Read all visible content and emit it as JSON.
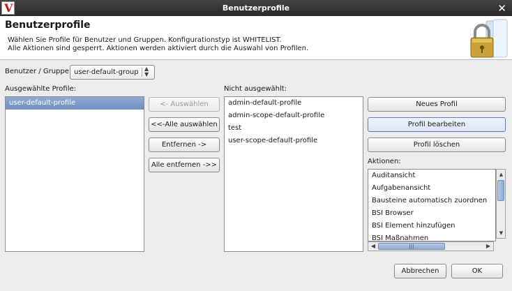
{
  "window": {
    "title": "Benutzerprofile",
    "close_glyph": "✕"
  },
  "header": {
    "title": "Benutzerprofile",
    "description_line1": "Wählen Sie Profile für Benutzer und Gruppen. Konfigurationstyp ist WHITELIST.",
    "description_line2": "Alle Aktionen sind gesperrt. Aktionen werden aktiviert durch die Auswahl von Profilen.",
    "icon": "lock-folder-icon"
  },
  "user_group": {
    "label": "Benutzer / Gruppe",
    "selected": "user-default-group"
  },
  "selected_profiles": {
    "label": "Ausgewählte Profile:",
    "items": [
      "user-default-profile"
    ],
    "selected_index": 0
  },
  "transfer_buttons": {
    "select": "<- Auswählen",
    "select_all": "<<-Alle auswählen",
    "remove": "Entfernen ->",
    "remove_all": "Alle entfernen ->>"
  },
  "not_selected": {
    "label": "Nicht ausgewählt:",
    "items": [
      "admin-default-profile",
      "admin-scope-default-profile",
      "test",
      "user-scope-default-profile"
    ]
  },
  "profile_buttons": {
    "new": "Neues Profil",
    "edit": "Profil bearbeiten",
    "delete": "Profil löschen"
  },
  "actions": {
    "label": "Aktionen:",
    "items": [
      "Auditansicht",
      "Aufgabenansicht",
      "Bausteine automatisch zuordnen",
      "BSI Browser",
      "BSI Element hinzufügen",
      "BSI Maßnahmen"
    ]
  },
  "footer": {
    "cancel": "Abbrechen",
    "ok": "OK"
  },
  "colors": {
    "selection": "#7f9dca",
    "titlebar": "#333333",
    "app_icon_red": "#d01010"
  }
}
